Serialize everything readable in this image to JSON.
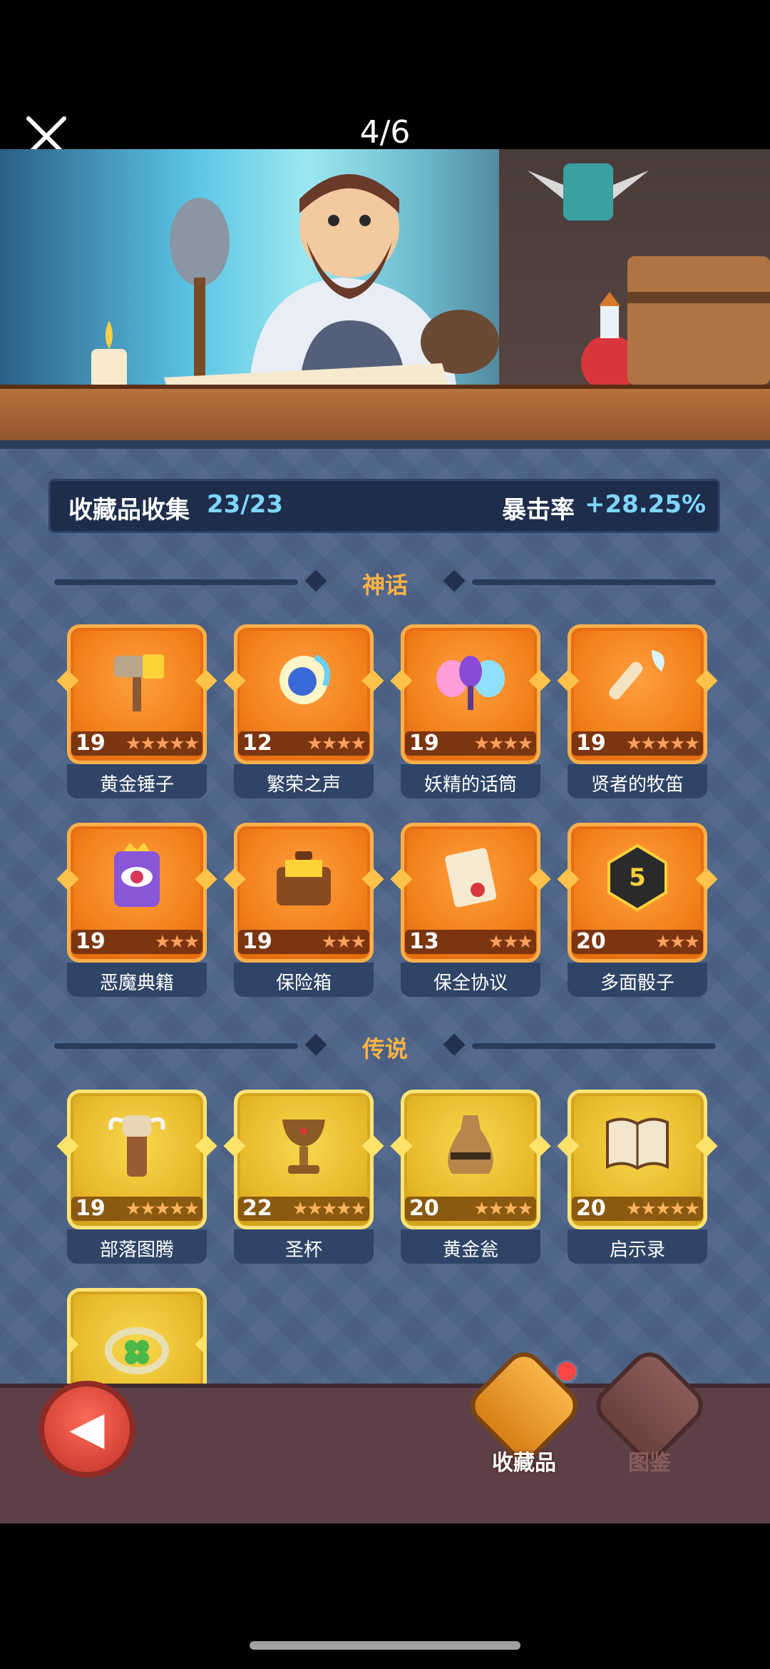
{
  "viewer": {
    "counter": "4/6",
    "close_icon": "close-icon"
  },
  "summary": {
    "collect_label": "收藏品收集",
    "collect_value": "23/23",
    "crit_label": "暴击率",
    "crit_value": "+28.25%"
  },
  "sections": {
    "mythic": {
      "title": "神话"
    },
    "legend": {
      "title": "传说"
    }
  },
  "mythic_items": [
    {
      "level": "19",
      "name": "黄金锤子",
      "icon": "hammer-icon",
      "stars": "★★★★★"
    },
    {
      "level": "12",
      "name": "繁荣之声",
      "icon": "swirl-orb-icon",
      "stars": "★★★★"
    },
    {
      "level": "19",
      "name": "妖精的话筒",
      "icon": "fairy-mic-icon",
      "stars": "★★★★"
    },
    {
      "level": "19",
      "name": "贤者的牧笛",
      "icon": "flute-icon",
      "stars": "★★★★★"
    },
    {
      "level": "19",
      "name": "恶魔典籍",
      "icon": "demon-book-icon",
      "stars": "★★★"
    },
    {
      "level": "19",
      "name": "保险箱",
      "icon": "treasure-chest-icon",
      "stars": "★★★"
    },
    {
      "level": "13",
      "name": "保全协议",
      "icon": "scroll-icon",
      "stars": "★★★"
    },
    {
      "level": "20",
      "name": "多面骰子",
      "icon": "dice-icon",
      "stars": "★★★"
    }
  ],
  "legend_items": [
    {
      "level": "19",
      "name": "部落图腾",
      "icon": "totem-icon",
      "stars": "★★★★★"
    },
    {
      "level": "22",
      "name": "圣杯",
      "icon": "grail-icon",
      "stars": "★★★★★"
    },
    {
      "level": "20",
      "name": "黄金瓮",
      "icon": "urn-icon",
      "stars": "★★★★"
    },
    {
      "level": "20",
      "name": "启示录",
      "icon": "open-book-icon",
      "stars": "★★★★★"
    },
    {
      "level": "",
      "name": "",
      "icon": "clover-ring-icon",
      "stars": ""
    }
  ],
  "bottom_nav": {
    "back_icon": "back-arrow-icon",
    "tabs": [
      {
        "label": "收藏品",
        "icon": "collection-icon",
        "active": true
      },
      {
        "label": "图鉴",
        "icon": "book-icon",
        "active": false
      }
    ]
  },
  "colors": {
    "panel_bg": "#4e6488",
    "accent_blue": "#7fd6ff",
    "section_title": "#ffb445",
    "mythic_tile": "#f17f19",
    "legend_tile": "#e7b92a"
  }
}
